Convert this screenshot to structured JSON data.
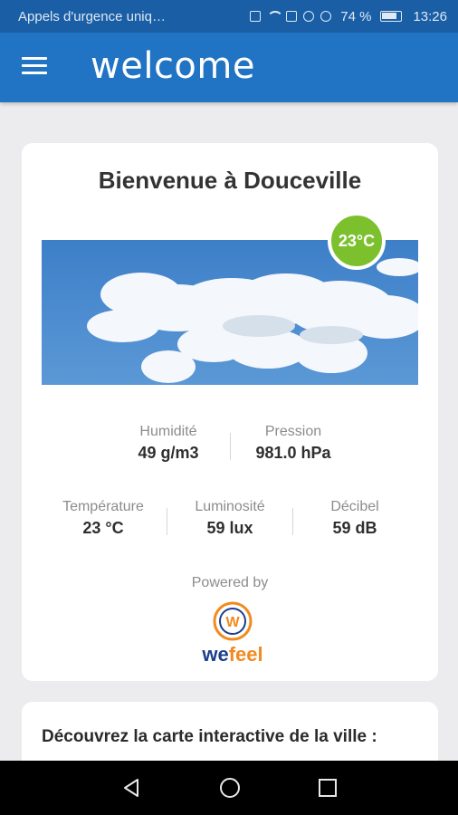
{
  "status_bar": {
    "carrier_text": "Appels d'urgence uniq…",
    "battery_percent": "74 %",
    "time": "13:26",
    "icons": [
      "sim-icon",
      "wifi-icon",
      "k-icon",
      "calendar-icon",
      "calendar-icon",
      "android-icon",
      "nfc-icon",
      "mute-icon",
      "battery-icon"
    ]
  },
  "app_bar": {
    "logo": "welcome",
    "menu_icon": "hamburger-menu-icon"
  },
  "main_card": {
    "title": "Bienvenue à Douceville",
    "temperature_badge": "23°C",
    "stats_row1": [
      {
        "label": "Humidité",
        "value": "49 g/m3"
      },
      {
        "label": "Pression",
        "value": "981.0 hPa"
      }
    ],
    "stats_row2": [
      {
        "label": "Température",
        "value": "23 °C"
      },
      {
        "label": "Luminosité",
        "value": "59 lux"
      },
      {
        "label": "Décibel",
        "value": "59 dB"
      }
    ],
    "powered_by": "Powered by",
    "partner_logo": {
      "part1": "we",
      "part2": "feel",
      "symbol": "W"
    }
  },
  "map_card": {
    "title": "Découvrez la carte interactive de la ville :"
  },
  "colors": {
    "status_bar": "#1a5fa6",
    "app_bar": "#2174c4",
    "temperature_badge": "#7cc12d",
    "background": "#ececee"
  },
  "nav_bar": {
    "icons": [
      "back-icon",
      "home-icon",
      "recent-apps-icon"
    ]
  }
}
